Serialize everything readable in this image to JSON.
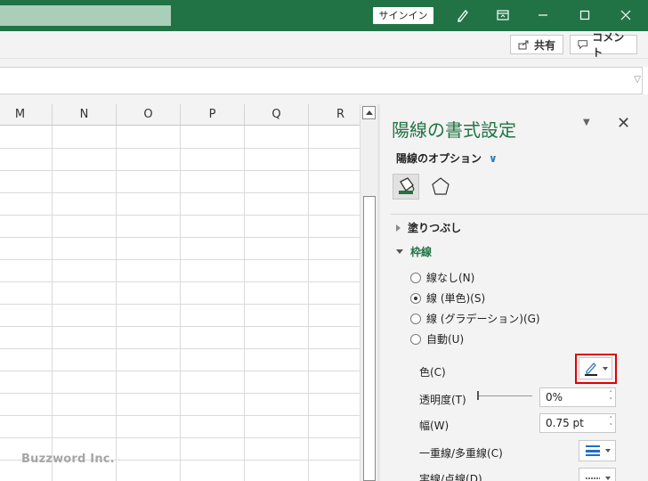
{
  "titlebar": {
    "signin_label": "サインイン"
  },
  "ribbon": {
    "share_label": "共有",
    "comment_label": "コメント"
  },
  "grid": {
    "columns": [
      "M",
      "N",
      "O",
      "P",
      "Q",
      "R"
    ],
    "watermark": "Buzzword Inc."
  },
  "pane": {
    "title": "陽線の書式設定",
    "options_label": "陽線のオプション",
    "sections": {
      "fill": "塗りつぶし",
      "line": "枠線"
    },
    "radios": [
      {
        "label": "線なし(N)",
        "selected": false
      },
      {
        "label": "線 (単色)(S)",
        "selected": true
      },
      {
        "label": "線 (グラデーション)(G)",
        "selected": false
      },
      {
        "label": "自動(U)",
        "selected": false
      }
    ],
    "props": {
      "color_label": "色(C)",
      "transparency_label": "透明度(T)",
      "transparency_value": "0%",
      "width_label": "幅(W)",
      "width_value": "0.75 pt",
      "compound_label": "一重線/多重線(C)",
      "dash_label": "実線/点線(D)"
    }
  },
  "colors": {
    "accent": "#217346",
    "highlight": "#e00000",
    "pen_blue": "#1f6fc5"
  }
}
